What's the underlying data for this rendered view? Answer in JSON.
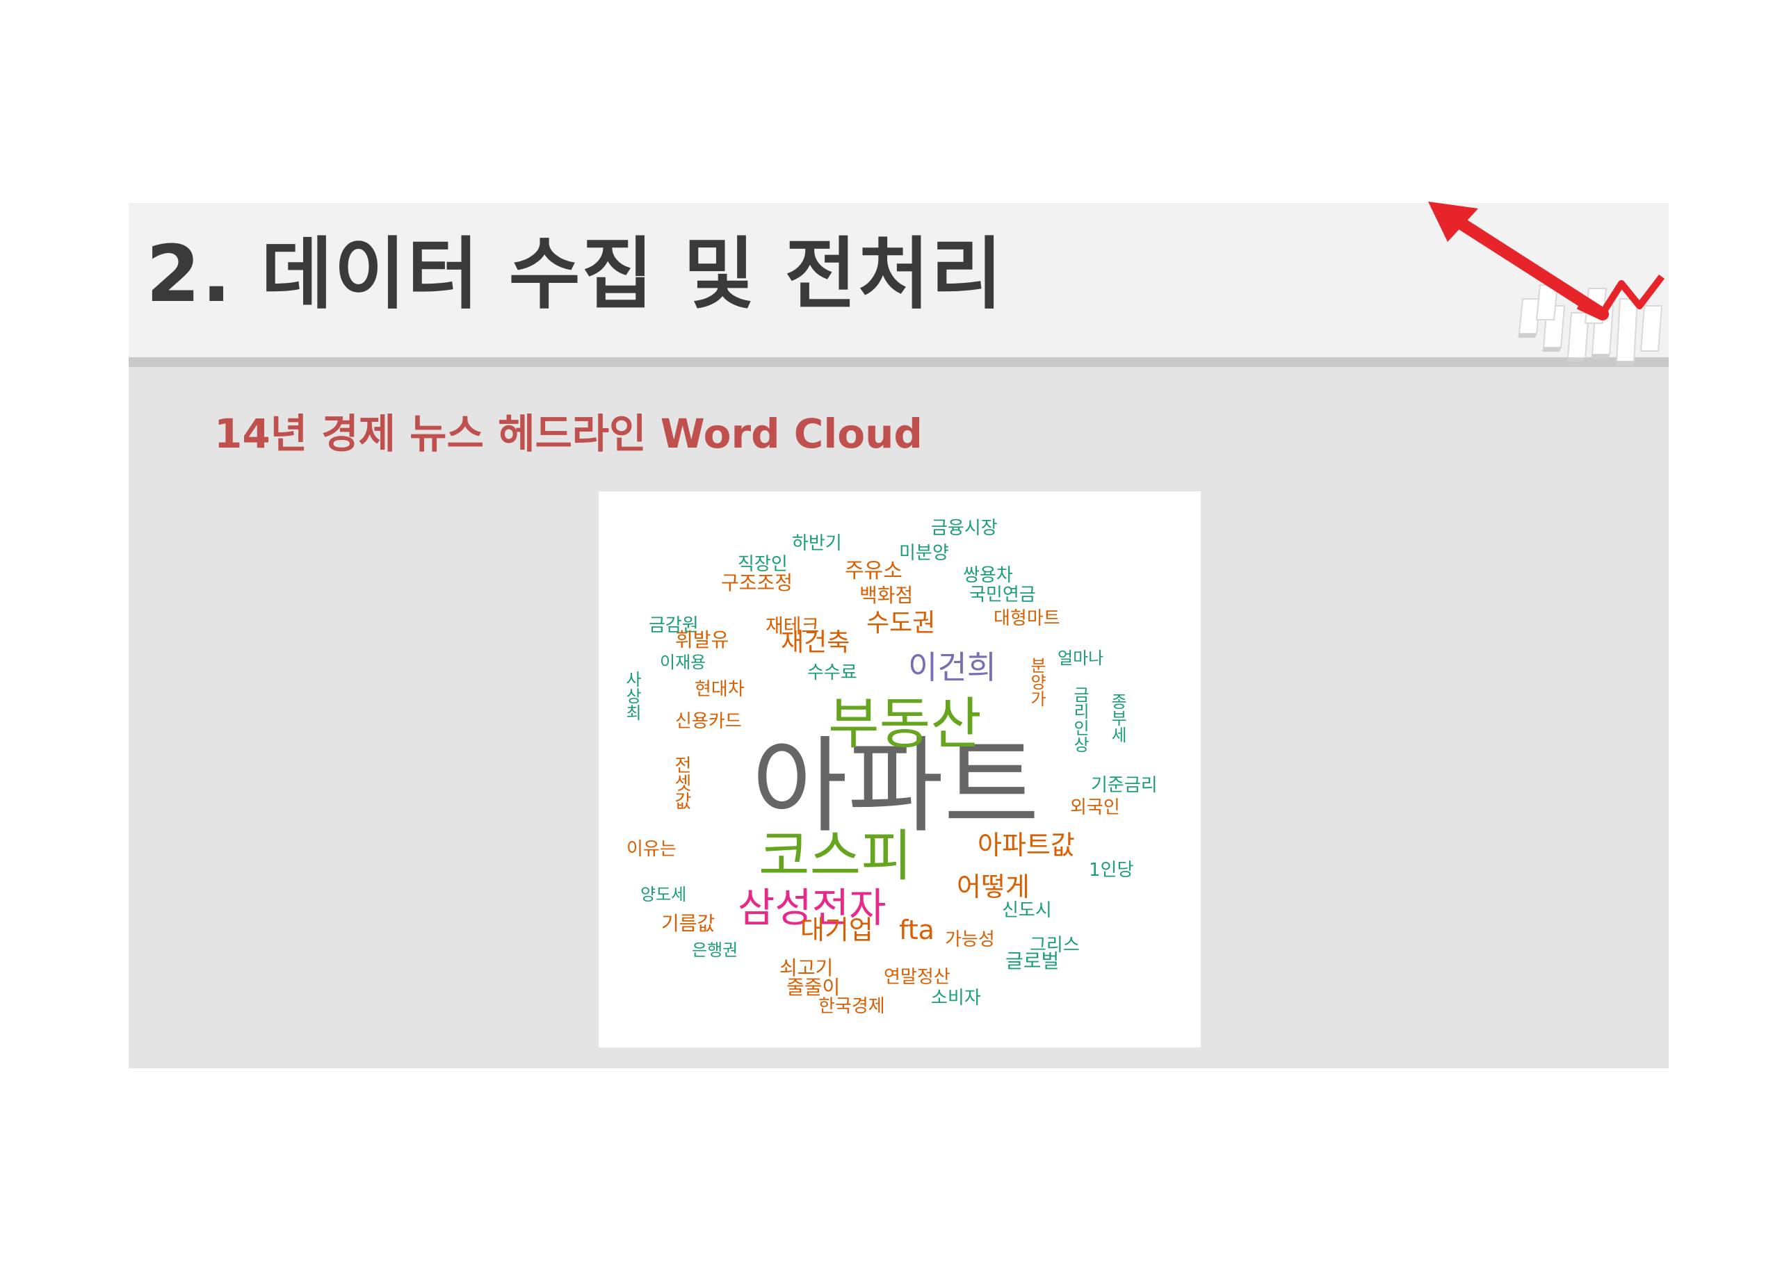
{
  "title": "2. 데이터 수집 및 전처리",
  "subtitle": "14년 경제 뉴스 헤드라인 Word Cloud",
  "decoration": {
    "icon": "red-trend-arrow-icon",
    "colors": {
      "arrow": "#e8242b",
      "blocks": "#ffffff"
    }
  },
  "colors": {
    "title": "#3a3a3a",
    "subtitle": "#c0504d",
    "panel_background": "#e4e4e4",
    "title_bar": "#f2f2f2",
    "cloud_background": "#ffffff"
  },
  "word_cloud": {
    "words": [
      {
        "text": "아파트",
        "color": "#666666",
        "weight": 100
      },
      {
        "text": "부동산",
        "color": "#66a61e",
        "weight": 55
      },
      {
        "text": "코스피",
        "color": "#66a61e",
        "weight": 50
      },
      {
        "text": "삼성전자",
        "color": "#e7298a",
        "weight": 40
      },
      {
        "text": "이건희",
        "color": "#7570b3",
        "weight": 32
      },
      {
        "text": "아파트값",
        "color": "#d95f02",
        "weight": 28
      },
      {
        "text": "어떻게",
        "color": "#d95f02",
        "weight": 28
      },
      {
        "text": "대기업",
        "color": "#d95f02",
        "weight": 28
      },
      {
        "text": "재건축",
        "color": "#d95f02",
        "weight": 26
      },
      {
        "text": "수도권",
        "color": "#d95f02",
        "weight": 26
      },
      {
        "text": "fta",
        "color": "#d95f02",
        "weight": 26
      },
      {
        "text": "금융시장",
        "color": "#1b9e77",
        "weight": 18
      },
      {
        "text": "하반기",
        "color": "#1b9e77",
        "weight": 18
      },
      {
        "text": "미분양",
        "color": "#1b9e77",
        "weight": 18
      },
      {
        "text": "직장인",
        "color": "#1b9e77",
        "weight": 18
      },
      {
        "text": "주유소",
        "color": "#d95f02",
        "weight": 22
      },
      {
        "text": "쌍용차",
        "color": "#1b9e77",
        "weight": 18
      },
      {
        "text": "구조조정",
        "color": "#d95f02",
        "weight": 20
      },
      {
        "text": "백화점",
        "color": "#d95f02",
        "weight": 20
      },
      {
        "text": "국민연금",
        "color": "#1b9e77",
        "weight": 18
      },
      {
        "text": "대형마트",
        "color": "#d95f02",
        "weight": 18
      },
      {
        "text": "금감원",
        "color": "#1b9e77",
        "weight": 18
      },
      {
        "text": "재테크",
        "color": "#d95f02",
        "weight": 20
      },
      {
        "text": "휘발유",
        "color": "#d95f02",
        "weight": 20
      },
      {
        "text": "이재용",
        "color": "#1b9e77",
        "weight": 16
      },
      {
        "text": "수수료",
        "color": "#1b9e77",
        "weight": 18
      },
      {
        "text": "얼마나",
        "color": "#1b9e77",
        "weight": 16
      },
      {
        "text": "현대차",
        "color": "#d95f02",
        "weight": 18
      },
      {
        "text": "사상최",
        "color": "#1b9e77",
        "weight": 16,
        "vertical": true
      },
      {
        "text": "분양가",
        "color": "#d95f02",
        "weight": 16,
        "vertical": true
      },
      {
        "text": "금리인상",
        "color": "#1b9e77",
        "weight": 16,
        "vertical": true
      },
      {
        "text": "종부세",
        "color": "#1b9e77",
        "weight": 16,
        "vertical": true
      },
      {
        "text": "신용카드",
        "color": "#d95f02",
        "weight": 18
      },
      {
        "text": "전셋값",
        "color": "#d95f02",
        "weight": 18,
        "vertical": true
      },
      {
        "text": "기준금리",
        "color": "#1b9e77",
        "weight": 18
      },
      {
        "text": "외국인",
        "color": "#d95f02",
        "weight": 18
      },
      {
        "text": "이유는",
        "color": "#d95f02",
        "weight": 18
      },
      {
        "text": "1인당",
        "color": "#1b9e77",
        "weight": 18
      },
      {
        "text": "양도세",
        "color": "#1b9e77",
        "weight": 16
      },
      {
        "text": "신도시",
        "color": "#1b9e77",
        "weight": 18
      },
      {
        "text": "기름값",
        "color": "#d95f02",
        "weight": 20
      },
      {
        "text": "가능성",
        "color": "#d95f02",
        "weight": 18
      },
      {
        "text": "그리스",
        "color": "#1b9e77",
        "weight": 18
      },
      {
        "text": "은행권",
        "color": "#1b9e77",
        "weight": 16
      },
      {
        "text": "글로벌",
        "color": "#1b9e77",
        "weight": 18
      },
      {
        "text": "쇠고기",
        "color": "#d95f02",
        "weight": 20
      },
      {
        "text": "연말정산",
        "color": "#d95f02",
        "weight": 18
      },
      {
        "text": "줄줄이",
        "color": "#d95f02",
        "weight": 18
      },
      {
        "text": "소비자",
        "color": "#1b9e77",
        "weight": 18
      },
      {
        "text": "한국경제",
        "color": "#d95f02",
        "weight": 18
      }
    ]
  }
}
